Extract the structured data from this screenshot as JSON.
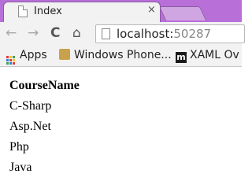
{
  "tab": {
    "title": "Index",
    "close": "×"
  },
  "toolbar": {
    "back": "←",
    "forward": "→",
    "reload": "C",
    "home": "⌂",
    "url_host": "localhost:",
    "url_port": "50287"
  },
  "bookmarks": [
    {
      "label": "Apps",
      "icon": "apps-grid-icon"
    },
    {
      "label": "Windows Phone...",
      "icon": "bookmark-favicon"
    },
    {
      "label": "XAML Ov",
      "icon": "m-logo-icon",
      "icon_text": "m"
    }
  ],
  "table": {
    "header": "CourseName",
    "rows": [
      "C-Sharp",
      "Asp.Net",
      "Php",
      "Java"
    ]
  },
  "colors": {
    "frame": "#b86fd8",
    "toolbar": "#f2f2f2"
  }
}
